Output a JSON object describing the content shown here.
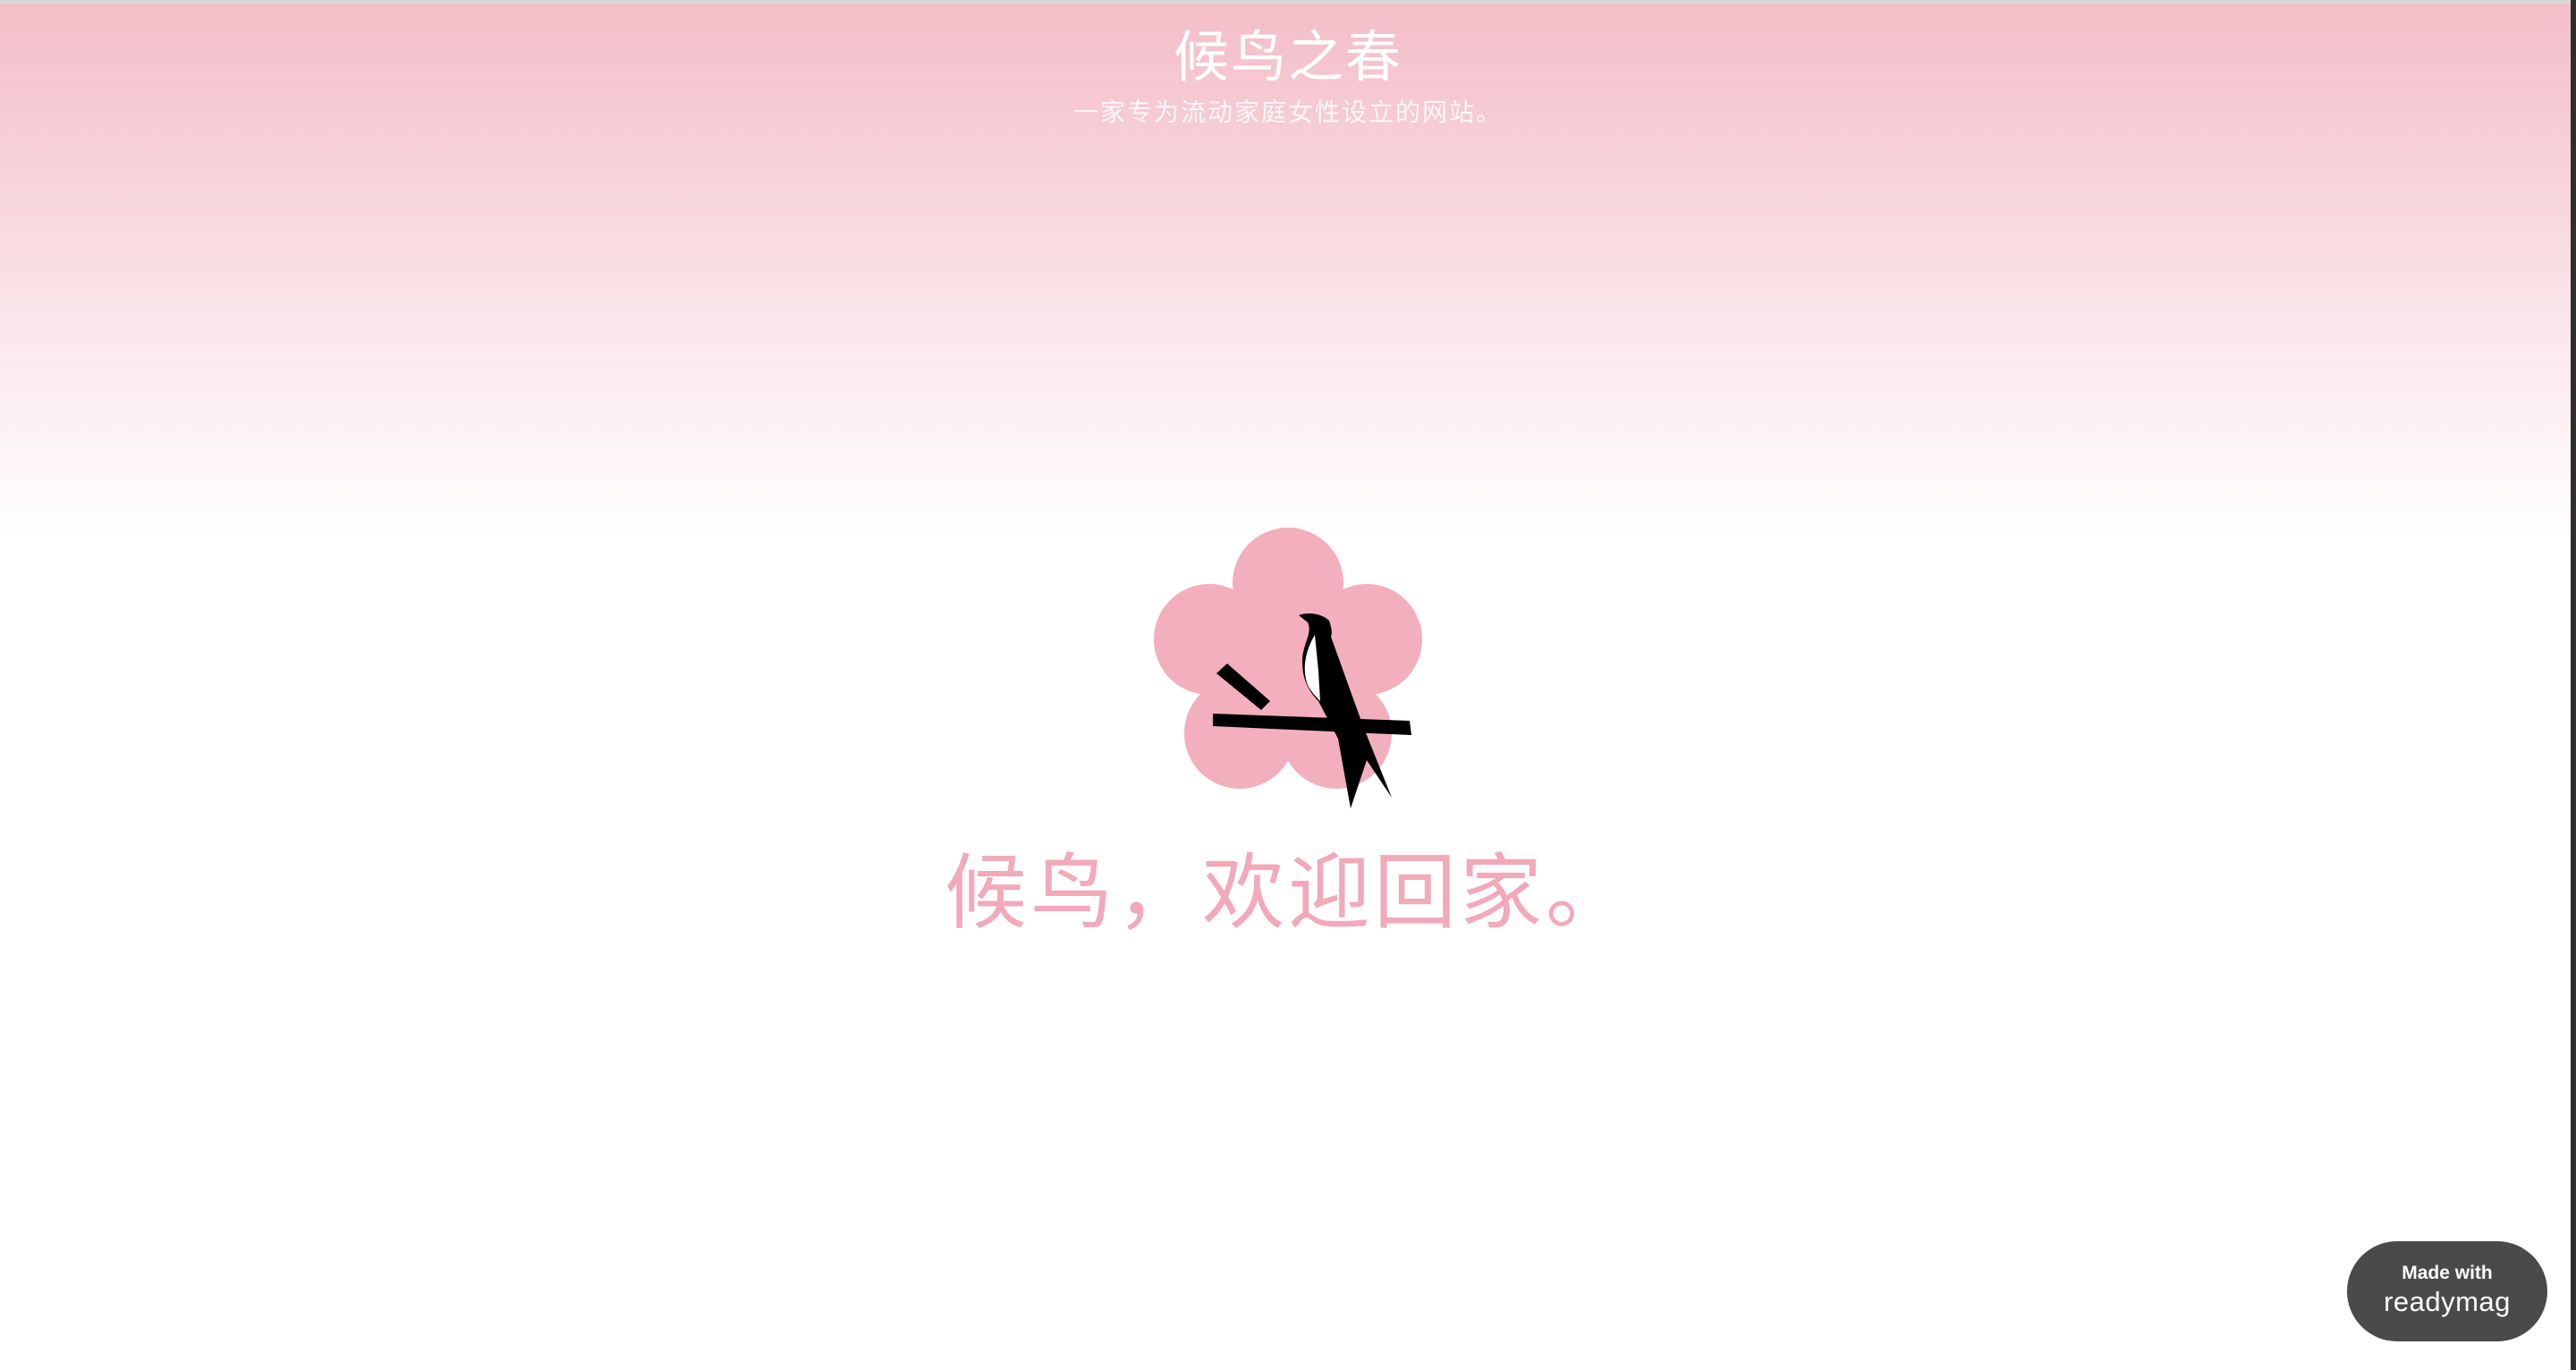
{
  "site": {
    "title": "候鸟之春",
    "subtitle": "一家专为流动家庭女性设立的网站。"
  },
  "logo": {
    "icon": "plum-blossom-swallow-icon",
    "blossom_color": "#f3afbd",
    "bird_color": "#000000"
  },
  "welcome": {
    "text": "候鸟，欢迎回家。",
    "color": "#f2a9b9"
  },
  "badge": {
    "line1": "Made with",
    "brand": "readymag",
    "background": "#4a4a4a"
  },
  "colors": {
    "gradient_top": "#f3bec8",
    "page_background": "#ffffff"
  }
}
